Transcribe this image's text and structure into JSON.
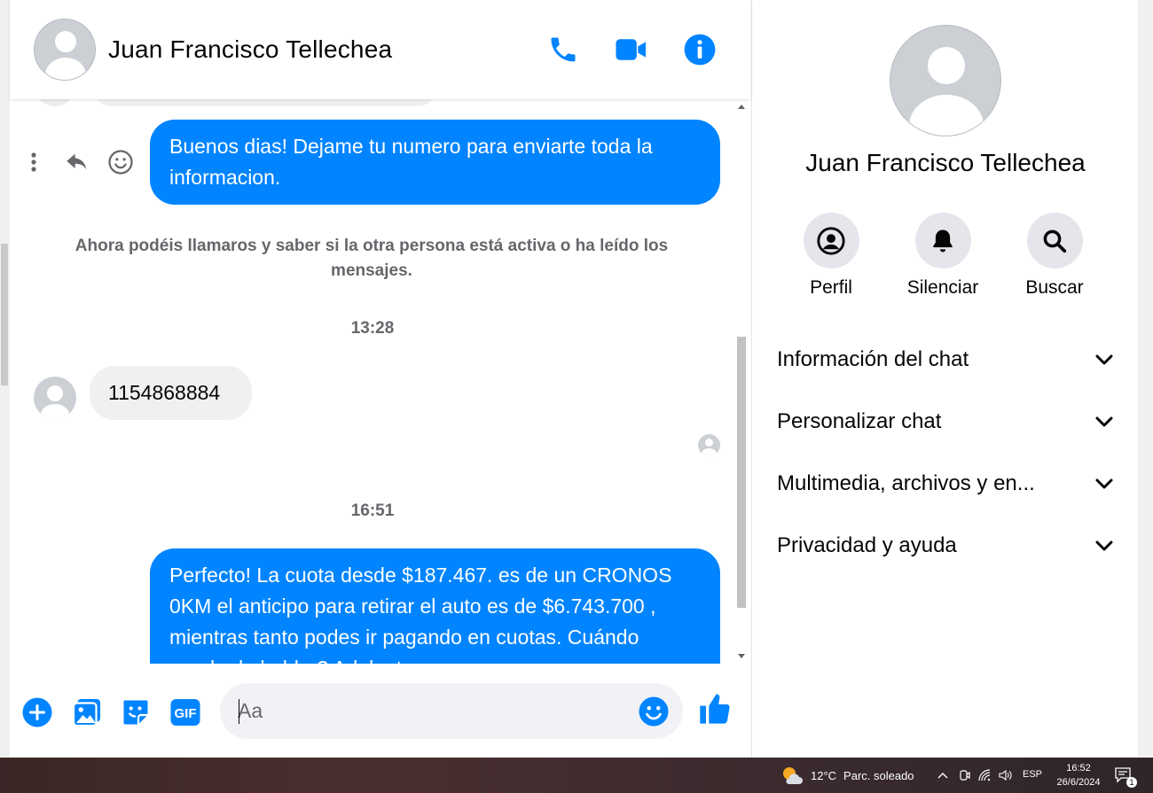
{
  "contact": {
    "name": "Juan Francisco Tellechea"
  },
  "header": {
    "icons": [
      "phone-icon",
      "video-icon",
      "info-icon"
    ]
  },
  "messages": [
    {
      "direction": "out",
      "text": "Buenos dias! Dejame tu numero para enviarte toda la informacion."
    },
    {
      "direction": "system",
      "text": "Ahora podéis llamaros y saber si la otra persona está activa o ha leído los mensajes."
    },
    {
      "direction": "time",
      "text": "13:28"
    },
    {
      "direction": "in",
      "text": "1154868884"
    },
    {
      "direction": "time",
      "text": "16:51"
    },
    {
      "direction": "out",
      "text": "Perfecto! La cuota desde $187.467. es de un CRONOS 0KM el anticipo para retirar el auto es de $6.743.700 , mientras tanto podes ir pagando en cuotas. Cuándo puedo de hablar? Adelanto una pocas"
    }
  ],
  "composer": {
    "placeholder": "Aa"
  },
  "info_panel": {
    "name": "Juan Francisco Tellechea",
    "actions": [
      {
        "label": "Perfil",
        "icon": "profile-icon"
      },
      {
        "label": "Silenciar",
        "icon": "bell-icon"
      },
      {
        "label": "Buscar",
        "icon": "search-icon"
      }
    ],
    "sections": [
      {
        "title": "Información del chat"
      },
      {
        "title": "Personalizar chat"
      },
      {
        "title": "Multimedia, archivos y en..."
      },
      {
        "title": "Privacidad y ayuda"
      }
    ]
  },
  "taskbar": {
    "temperature": "12°C",
    "weather": "Parc. soleado",
    "language": "ESP",
    "time": "16:52",
    "date": "26/6/2024",
    "notification_count": "1"
  },
  "colors": {
    "accent": "#0084ff",
    "bubble_in": "#f0f0f0",
    "muted_text": "#65676b"
  }
}
